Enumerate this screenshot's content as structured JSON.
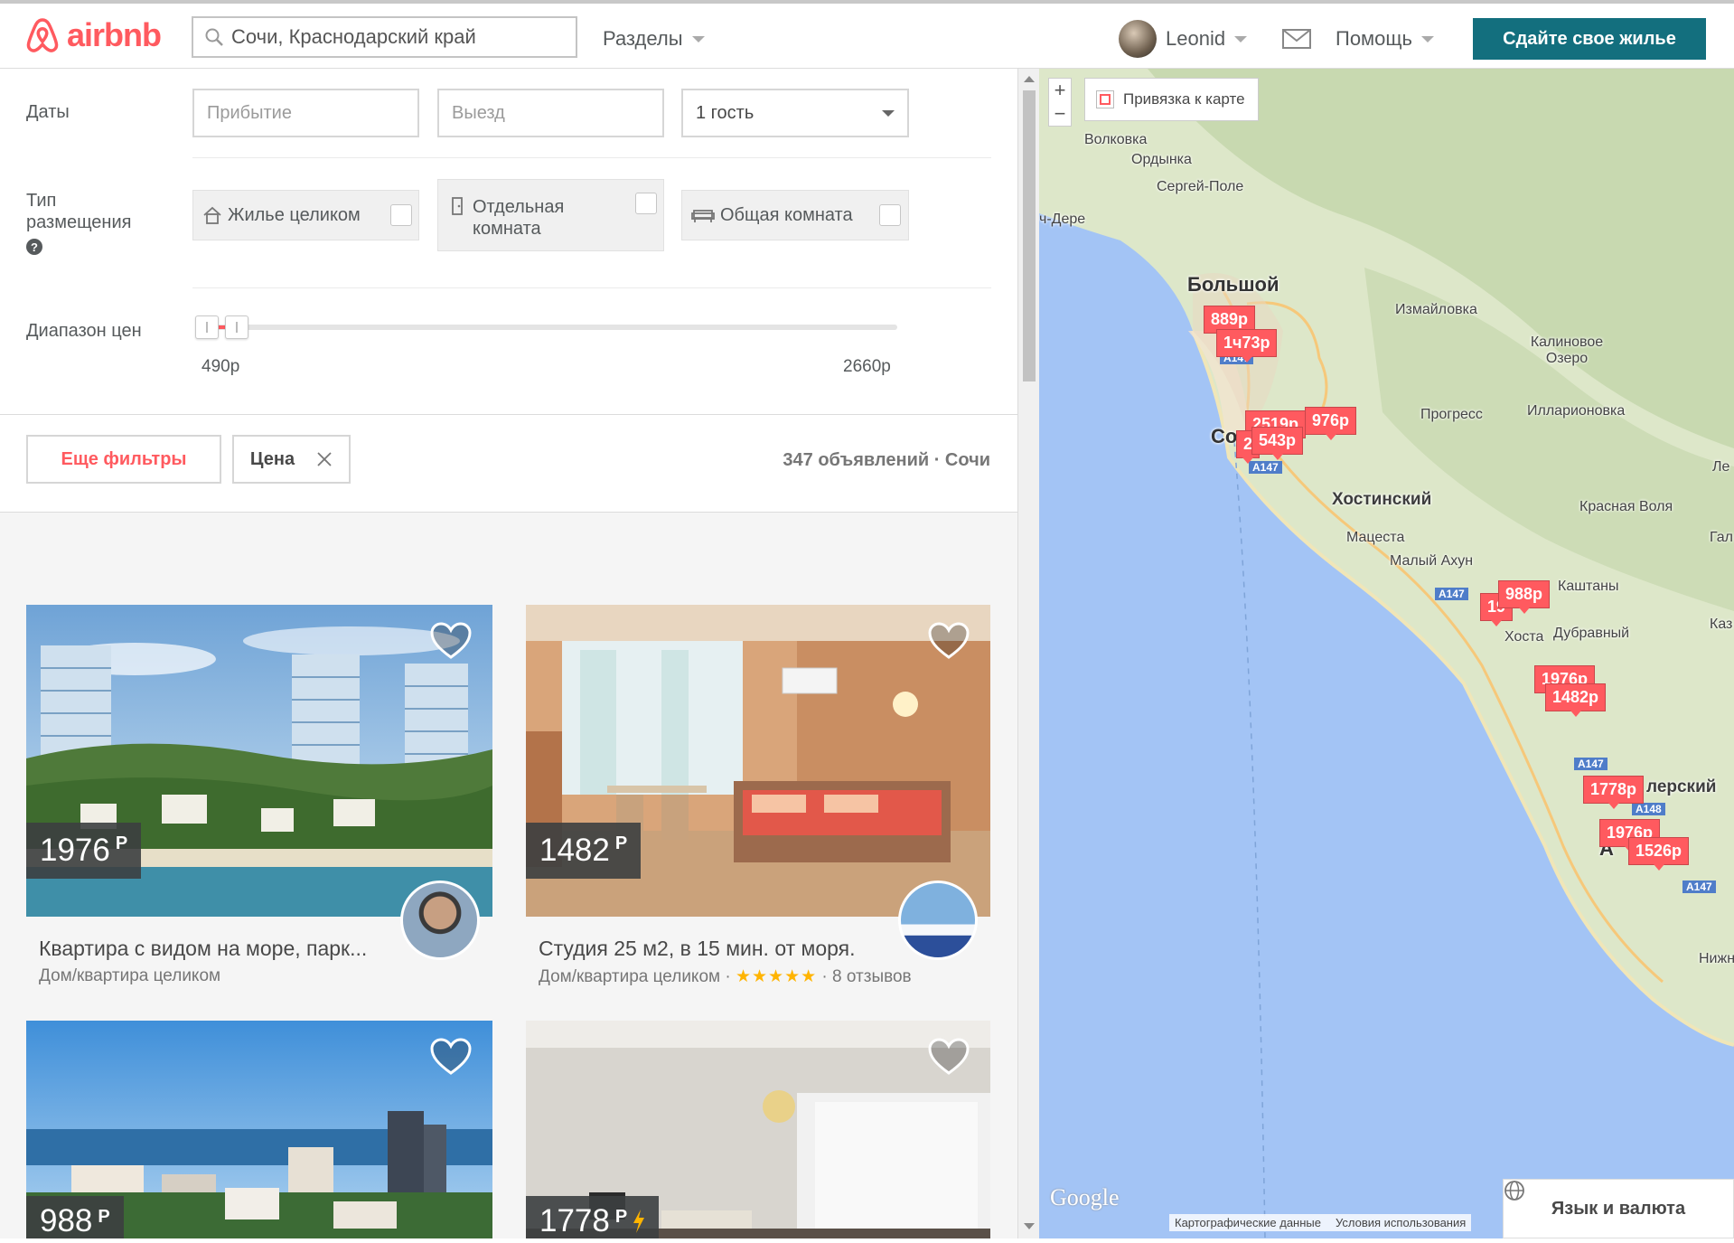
{
  "header": {
    "logo_text": "airbnb",
    "search_value": "Сочи, Краснодарский край",
    "sections_label": "Разделы",
    "user_name": "Leonid",
    "help_label": "Помощь",
    "host_button": "Сдайте свое жилье"
  },
  "filters": {
    "dates_label": "Даты",
    "checkin_placeholder": "Прибытие",
    "checkout_placeholder": "Выезд",
    "guests_value": "1 гость",
    "room_type_label": "Тип размещения",
    "room_types": [
      "Жилье целиком",
      "Отдельная комната",
      "Общая комната"
    ],
    "price_range_label": "Диапазон цен",
    "price_min": "490р",
    "price_max": "2660р",
    "price_selected_fraction": [
      0.0,
      0.05
    ],
    "more_filters": "Еще фильтры",
    "price_chip": "Цена",
    "results_count": "347 объявлений · Сочи"
  },
  "listings": [
    {
      "price": "1976",
      "currency": "Р",
      "title": "Квартира с видом на море, парк...",
      "subtitle": "Дом/квартира целиком",
      "stars": "",
      "reviews": ""
    },
    {
      "price": "1482",
      "currency": "Р",
      "title": "Студия 25 м2, в 15 мин. от моря.",
      "subtitle": "Дом/квартира целиком · ",
      "stars": "★★★★★",
      "reviews": " · 8 отзывов"
    },
    {
      "price": "988",
      "currency": "Р",
      "title": "",
      "subtitle": ""
    },
    {
      "price": "1778",
      "currency": "Р",
      "title": "",
      "subtitle": ""
    }
  ],
  "map": {
    "bind_label": "Привязка к карте",
    "zoom_in": "+",
    "zoom_out": "−",
    "places": [
      "Волковка",
      "Ордынка",
      "Сергей-Поле",
      "ч-Дере",
      "Большой",
      "Измайловка",
      "Калиновое Озеро",
      "Прогресс",
      "Илларионовка",
      "Со",
      "Хостинский",
      "Мацеста",
      "Малый Ахун",
      "Красная Воля",
      "Каштаны",
      "Хоста",
      "Дубравный",
      "лерский",
      "А",
      "Нижне",
      "Ле",
      "Гал",
      "Каз"
    ],
    "pins": [
      "889р",
      "1ч73р",
      "2519р",
      "976р",
      "2",
      "543р",
      "19",
      "988р",
      "1976р",
      "1482р",
      "1778р",
      "1976р",
      "1526р"
    ],
    "roads": [
      "A147",
      "A147",
      "A147",
      "A147",
      "A148",
      "A147"
    ],
    "attribution": [
      "Картографические данные",
      "Условия использования"
    ],
    "google": "Google",
    "lang_button": "Язык и валюта"
  },
  "colors": {
    "brand": "#ff5a5f",
    "host_button": "#136f7e",
    "water": "#a3c4f5",
    "land": "#d7e4c4"
  }
}
